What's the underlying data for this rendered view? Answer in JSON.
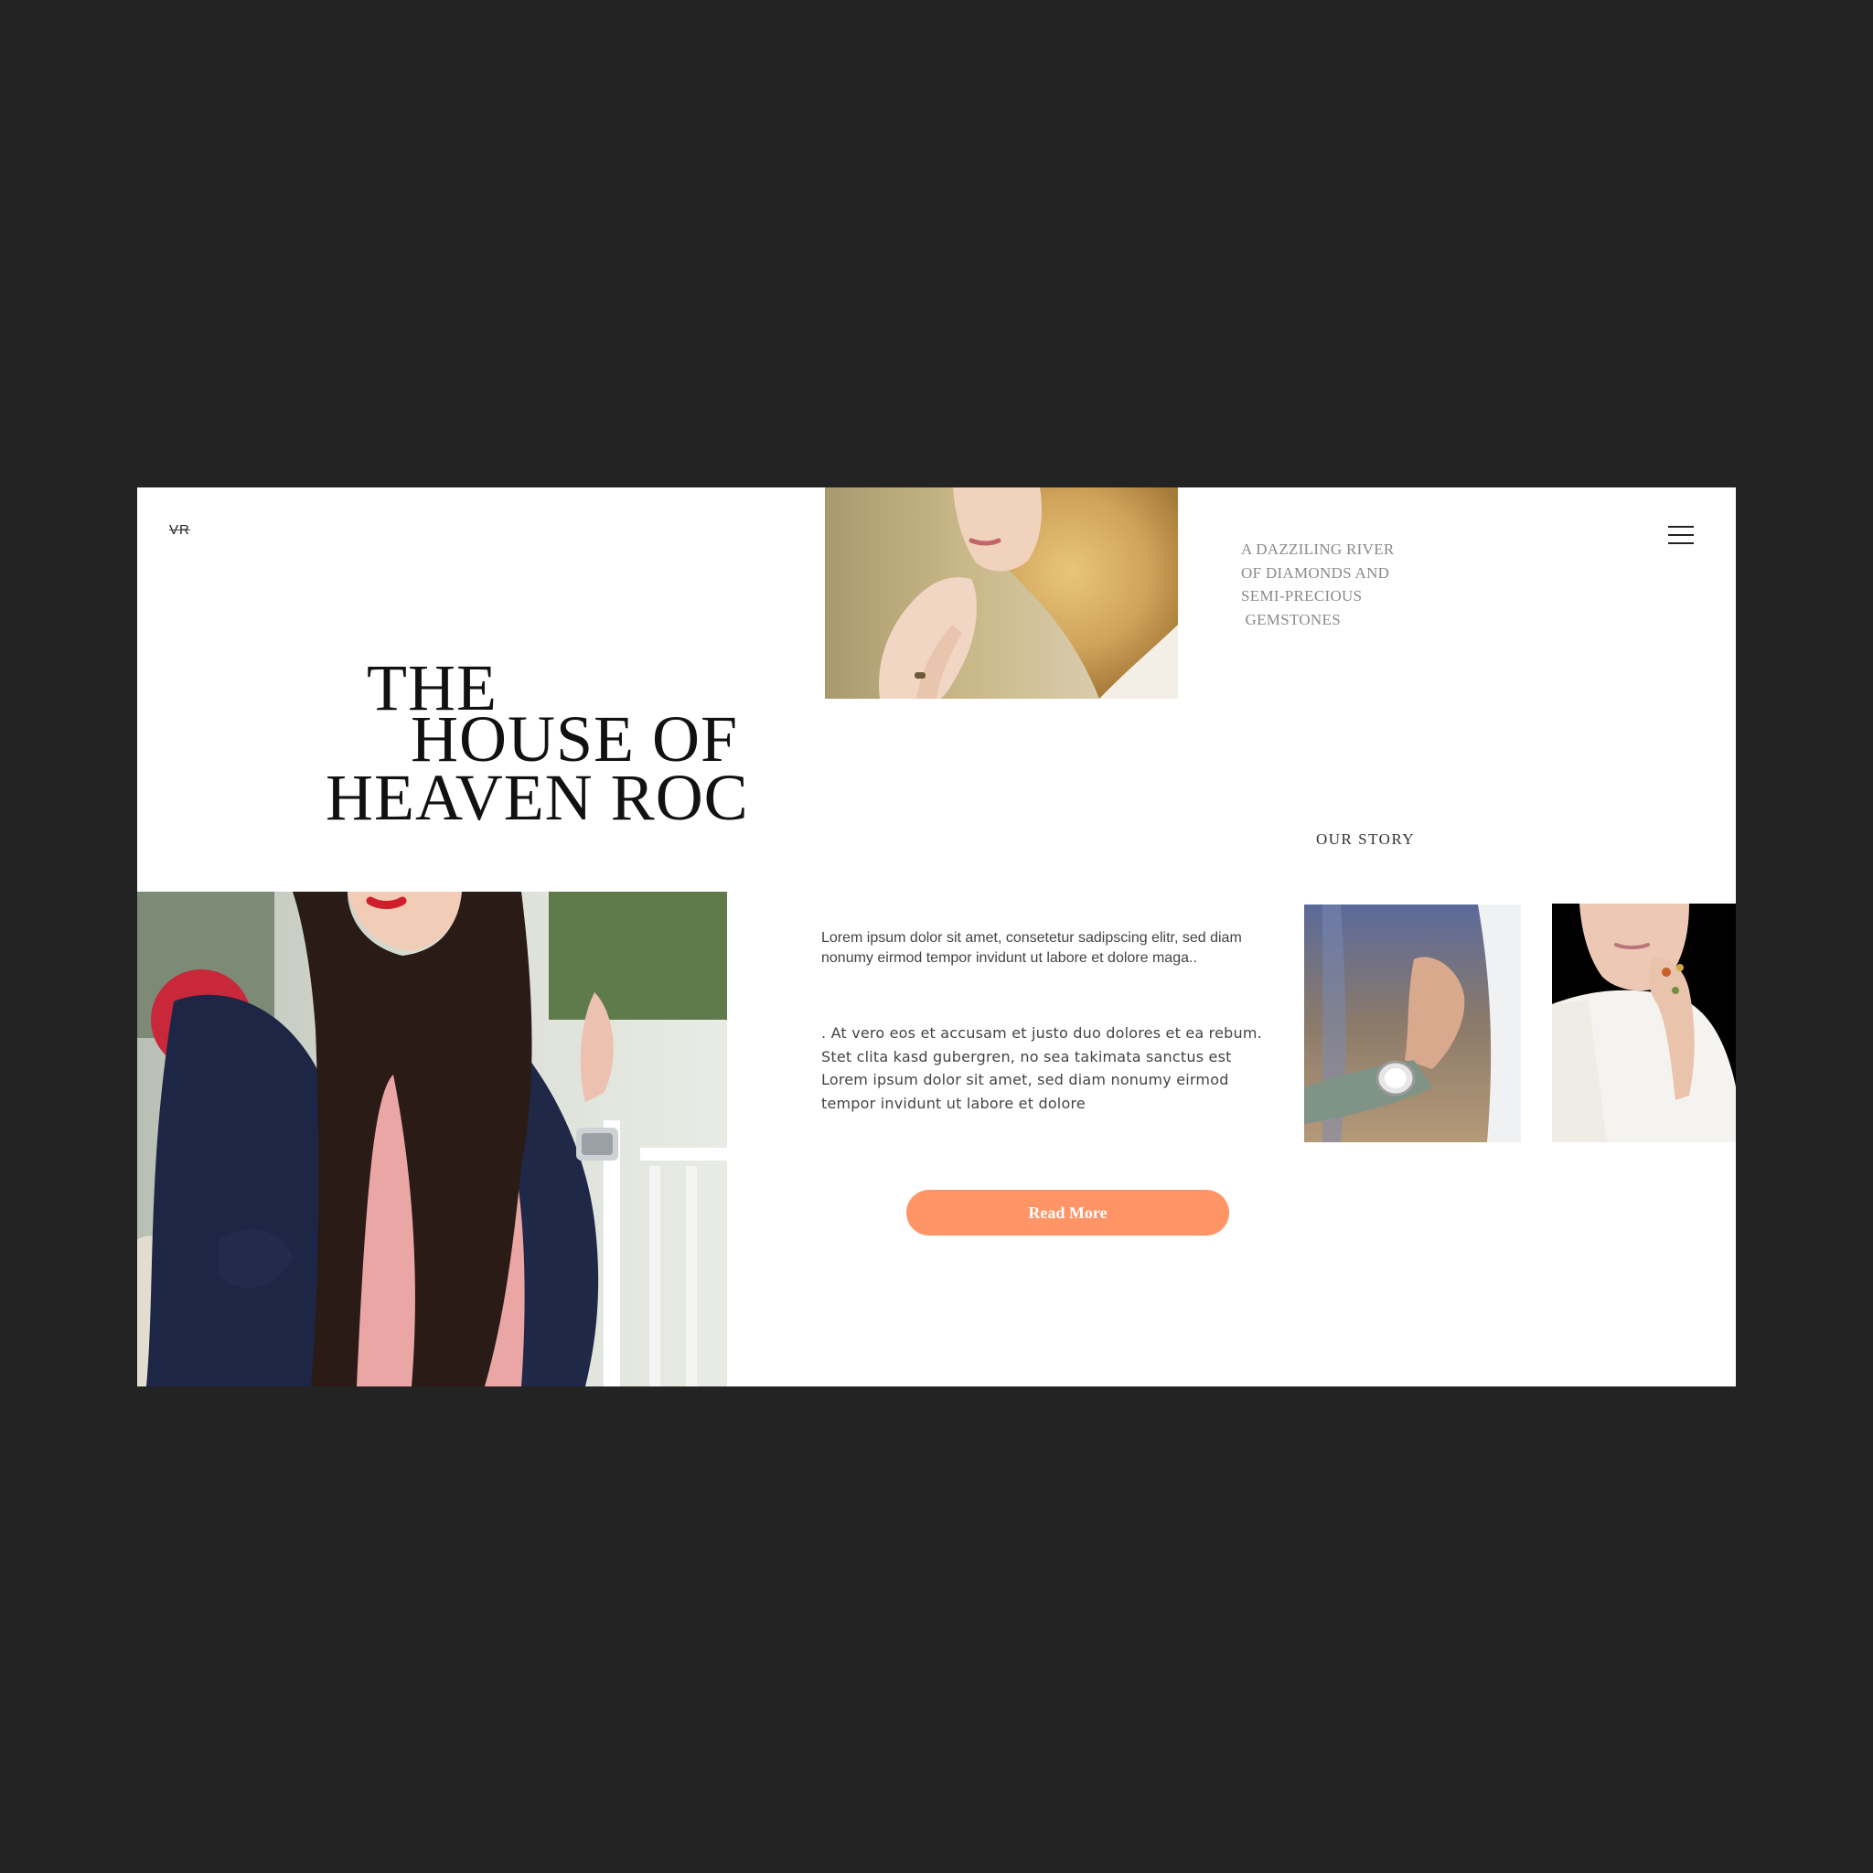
{
  "brand": {
    "logo_text": "VR"
  },
  "header": {
    "menu_icon": "hamburger-menu-icon"
  },
  "hero": {
    "title_line1": "THE",
    "title_line2": "HOUSE OF",
    "title_line3": "HEAVEN ROC"
  },
  "tagline": {
    "line1": "A DAZZILING RIVER",
    "line2": "OF DIAMONDS AND",
    "line3": "SEMI-PRECIOUS",
    "line4": " GEMSTONES"
  },
  "story": {
    "title": "OUR STORY",
    "intro": "Lorem ipsum dolor sit amet, consetetur sadipscing elitr, sed diam nonumy eirmod tempor invidunt ut labore et dolore maga..",
    "body": ". At vero eos et accusam et justo duo dolores et ea rebum. Stet clita kasd gubergren, no sea takimata sanctus est Lorem ipsum dolor sit amet, sed diam nonumy eirmod tempor invidunt ut labore et dolore",
    "button_label": "Read More"
  },
  "colors": {
    "page_background": "#232323",
    "card_background": "#ffffff",
    "accent": "#ff9567"
  }
}
